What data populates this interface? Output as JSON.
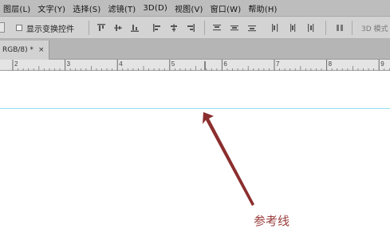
{
  "menu": {
    "items": [
      {
        "label": "图层(L)"
      },
      {
        "label": "文字(Y)"
      },
      {
        "label": "选择(S)"
      },
      {
        "label": "滤镜(T)"
      },
      {
        "label": "3D(D)"
      },
      {
        "label": "视图(V)"
      },
      {
        "label": "窗口(W)"
      },
      {
        "label": "帮助(H)"
      }
    ]
  },
  "options": {
    "show_transform_controls": "显示变换控件",
    "mode_3d": "3D 模式"
  },
  "tab": {
    "label": "RGB/8) *",
    "close_icon": "×"
  },
  "ruler": {
    "labels": [
      "2",
      "3",
      "4",
      "5",
      "6",
      "7",
      "8",
      "9"
    ]
  },
  "annotation": {
    "label": "参考线",
    "color": "#8b2e2e"
  },
  "colors": {
    "guide": "#8ee2ee",
    "menubar": "#bdbdbd"
  }
}
